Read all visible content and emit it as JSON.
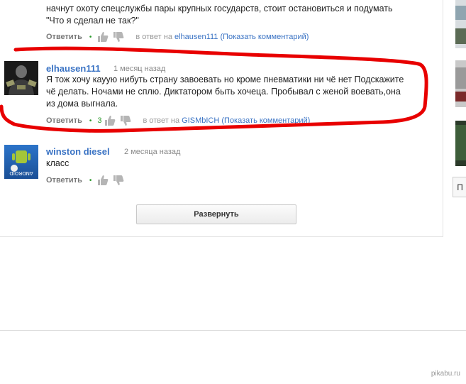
{
  "comments": [
    {
      "text_line1": "начнут охоту спецслужбы пары крупных государств, стоит остановиться и подумать",
      "text_line2": "\"Что я сделал не так?\"",
      "reply_label": "Ответить",
      "in_reply_prefix": "в ответ на",
      "in_reply_user": "elhausen111",
      "show_comment": "(Показать комментарий)"
    },
    {
      "author": "elhausen111",
      "time": "1 месяц назад",
      "text_line1": "Я тож хочу кауую нибуть страну завоевать но кроме пневматики ни чё нет Подскажите",
      "text_line2": "чё делать. Ночами не сплю. Диктатором быть хочеца. Пробывал с женой воевать,она",
      "text_line3": "из дома выгнала.",
      "reply_label": "Ответить",
      "likes": "3",
      "in_reply_prefix": "в ответ на",
      "in_reply_user": "GISMbICH",
      "show_comment": "(Показать комментарий)"
    },
    {
      "author": "winston diesel",
      "time": "2 месяца назад",
      "text_line1": "класс",
      "reply_label": "Ответить",
      "avatar_label": "ANDROID"
    }
  ],
  "expand_button": "Развернуть",
  "sidebar": {
    "button_label": "П"
  },
  "watermark": "pikabu.ru",
  "colors": {
    "link": "#3a73c4",
    "annotation": "#e80000",
    "likes": "#2a9a2a"
  }
}
